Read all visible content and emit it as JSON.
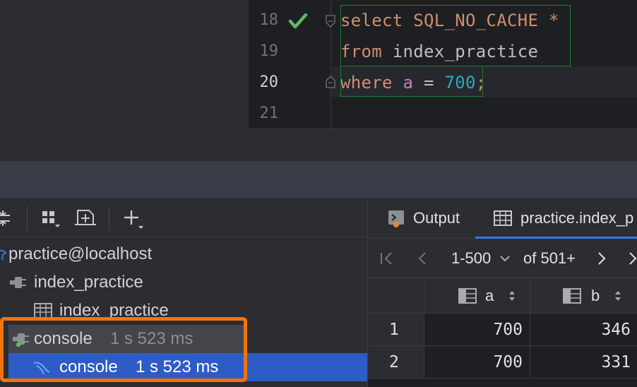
{
  "editor": {
    "lines": [
      {
        "number": "18",
        "tokens": [
          {
            "t": "select",
            "c": "kw"
          },
          {
            "t": " SQL_NO_CACHE ",
            "c": "kw"
          },
          {
            "t": "*",
            "c": "kw"
          }
        ]
      },
      {
        "number": "19",
        "tokens": [
          {
            "t": "from",
            "c": "kw"
          },
          {
            "t": " index_practice",
            "c": "id"
          }
        ]
      },
      {
        "number": "20",
        "tokens": [
          {
            "t": "where",
            "c": "kw"
          },
          {
            "t": " a",
            "c": "col"
          },
          {
            "t": " = ",
            "c": "id"
          },
          {
            "t": "700",
            "c": "num"
          },
          {
            "t": ";",
            "c": "punct"
          }
        ]
      },
      {
        "number": "21",
        "tokens": []
      }
    ],
    "line18": {
      "kw1": "select",
      "kw2": " SQL_NO_CACHE ",
      "star": "*"
    },
    "line19": {
      "kw": "from",
      "ident": " index_practice"
    },
    "line20": {
      "kw": "where",
      "col": " a",
      "op": " = ",
      "num": "700",
      "semi": ";"
    },
    "colors": {
      "keyword": "#cf8e6d",
      "identifier": "#bcbec4",
      "column": "#c77dbb",
      "number": "#2aacb8",
      "success": "#5fb865"
    }
  },
  "tree": {
    "datasource": "practice@localhost",
    "schema": "index_practice",
    "table": "index_practice",
    "console_parent": {
      "label": "console",
      "time": "1 s 523 ms"
    },
    "console_child": {
      "label": "console",
      "time": "1 s 523 ms"
    }
  },
  "results": {
    "tabs": [
      {
        "label": "Output",
        "icon": "output-icon"
      },
      {
        "label": "practice.index_p",
        "icon": "table-icon"
      }
    ],
    "pager": {
      "range": "1-500",
      "of": "of 501+"
    },
    "columns": [
      "a",
      "b"
    ],
    "rows": [
      {
        "num": "1",
        "a": "700",
        "b": "346"
      },
      {
        "num": "2",
        "a": "700",
        "b": "331"
      }
    ]
  },
  "colors": {
    "accent": "#3574f0",
    "selection": "#2e5cc6",
    "highlight": "#f4730c"
  }
}
